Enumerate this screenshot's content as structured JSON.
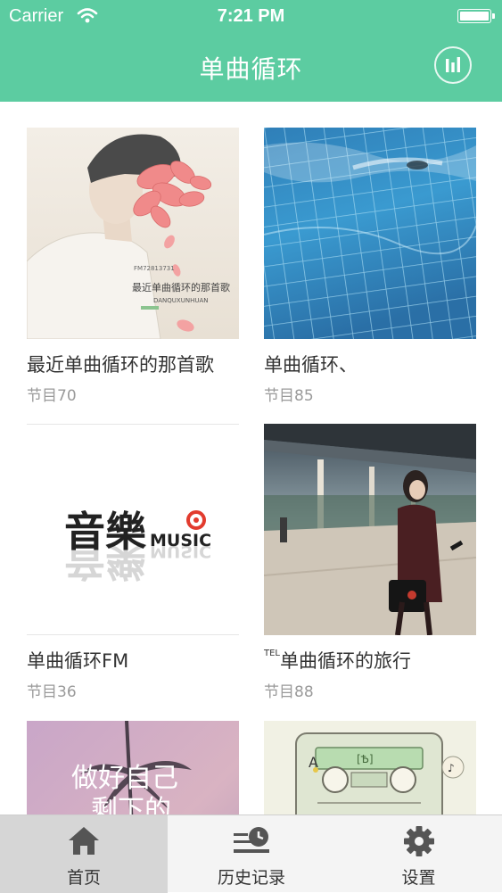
{
  "status_bar": {
    "carrier": "Carrier",
    "time": "7:21 PM"
  },
  "nav": {
    "title": "单曲循环",
    "right_icon": "equalizer-bars-icon"
  },
  "playlists": [
    {
      "title": "最近单曲循环的那首歌",
      "count": "节目70",
      "cover_text": [
        "最近单曲循环的那首歌",
        "DANQUXUNHUAN"
      ]
    },
    {
      "title": "单曲循环、",
      "count": "节目85"
    },
    {
      "title": "单曲循环FM",
      "count": "节目36",
      "cover_text": [
        "音樂",
        "MUSIC"
      ]
    },
    {
      "title_prefix": "TEL",
      "title": "单曲循环的旅行",
      "count": "节目88"
    },
    {
      "cover_text": [
        "做好自己",
        "剩下的"
      ]
    },
    {
      "cover_text": [
        "A"
      ]
    }
  ],
  "tabs": [
    {
      "label": "首页",
      "icon": "home-icon",
      "active": true
    },
    {
      "label": "历史记录",
      "icon": "history-clock-icon",
      "active": false
    },
    {
      "label": "设置",
      "icon": "gear-icon",
      "active": false
    }
  ],
  "colors": {
    "accent": "#5ccca1",
    "tab_active_bg": "#d6d6d6"
  }
}
